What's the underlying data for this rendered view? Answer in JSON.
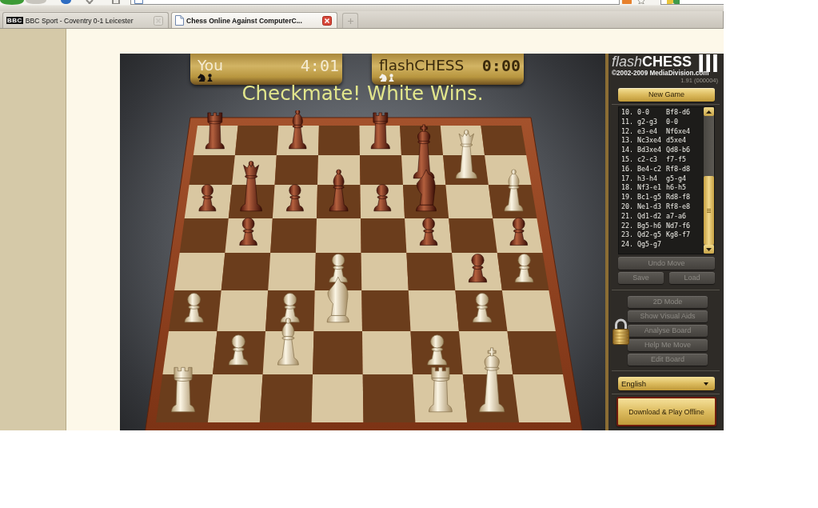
{
  "browser": {
    "tabs": [
      {
        "logo": "BBC",
        "title": "BBC Sport - Coventry 0-1 Leicester",
        "selected": false
      },
      {
        "title": "Chess Online Against ComputerC...",
        "selected": true
      }
    ]
  },
  "game": {
    "players": [
      {
        "name": "You",
        "clock": "4:01",
        "active": true,
        "captured": [
          {
            "kind": "knight",
            "white": false
          },
          {
            "kind": "pawn",
            "white": false
          }
        ]
      },
      {
        "name": "flashCHESS",
        "clock": "0:00",
        "active": false,
        "captured": [
          {
            "kind": "knight",
            "white": true
          },
          {
            "kind": "pawn",
            "white": true
          }
        ]
      }
    ],
    "status": "Checkmate! White Wins.",
    "board": {
      "ranks": [
        [
          {
            "kind": "rook",
            "white": false
          },
          {
            "kind": "empty"
          },
          {
            "kind": "bishop",
            "white": false
          },
          {
            "kind": "empty"
          },
          {
            "kind": "rook",
            "white": false
          },
          {
            "kind": "empty"
          },
          {
            "kind": "empty"
          },
          {
            "kind": "empty"
          }
        ],
        [
          {
            "kind": "empty"
          },
          {
            "kind": "empty"
          },
          {
            "kind": "empty"
          },
          {
            "kind": "empty"
          },
          {
            "kind": "empty"
          },
          {
            "kind": "king",
            "white": false
          },
          {
            "kind": "queen",
            "white": true
          },
          {
            "kind": "empty"
          }
        ],
        [
          {
            "kind": "pawn",
            "white": false
          },
          {
            "kind": "queen",
            "white": false
          },
          {
            "kind": "pawn",
            "white": false
          },
          {
            "kind": "bishop",
            "white": false
          },
          {
            "kind": "pawn",
            "white": false
          },
          {
            "kind": "knight",
            "white": false
          },
          {
            "kind": "empty"
          },
          {
            "kind": "bishop",
            "white": true
          }
        ],
        [
          {
            "kind": "empty"
          },
          {
            "kind": "pawn",
            "white": false
          },
          {
            "kind": "empty"
          },
          {
            "kind": "empty"
          },
          {
            "kind": "empty"
          },
          {
            "kind": "pawn",
            "white": false
          },
          {
            "kind": "empty"
          },
          {
            "kind": "pawn",
            "white": false
          }
        ],
        [
          {
            "kind": "empty"
          },
          {
            "kind": "empty"
          },
          {
            "kind": "empty"
          },
          {
            "kind": "pawn",
            "white": true
          },
          {
            "kind": "empty"
          },
          {
            "kind": "empty"
          },
          {
            "kind": "pawn",
            "white": false
          },
          {
            "kind": "pawn",
            "white": true
          }
        ],
        [
          {
            "kind": "pawn",
            "white": true
          },
          {
            "kind": "empty"
          },
          {
            "kind": "pawn",
            "white": true
          },
          {
            "kind": "knight",
            "white": true
          },
          {
            "kind": "empty"
          },
          {
            "kind": "empty"
          },
          {
            "kind": "pawn",
            "white": true
          },
          {
            "kind": "empty"
          }
        ],
        [
          {
            "kind": "empty"
          },
          {
            "kind": "pawn",
            "white": true
          },
          {
            "kind": "bishop",
            "white": true
          },
          {
            "kind": "empty"
          },
          {
            "kind": "empty"
          },
          {
            "kind": "pawn",
            "white": true
          },
          {
            "kind": "empty"
          },
          {
            "kind": "empty"
          }
        ],
        [
          {
            "kind": "rook",
            "white": true
          },
          {
            "kind": "empty"
          },
          {
            "kind": "empty"
          },
          {
            "kind": "empty"
          },
          {
            "kind": "empty"
          },
          {
            "kind": "rook",
            "white": true
          },
          {
            "kind": "king",
            "white": true
          },
          {
            "kind": "empty"
          }
        ]
      ]
    }
  },
  "panel": {
    "logo": {
      "prefix": "flash",
      "name": "CHESS",
      "numeral": "III"
    },
    "copyright": "©2002-2009 MediaDivision.com",
    "version": "1.91 (000004)",
    "new_game": {
      "label": "New Game",
      "disabled": false
    },
    "moves": [
      {
        "number": "10.",
        "white": "0-0",
        "black": "Bf8-d6"
      },
      {
        "number": "11.",
        "white": "g2-g3",
        "black": "0-0"
      },
      {
        "number": "12.",
        "white": "e3-e4",
        "black": "Nf6xe4"
      },
      {
        "number": "13.",
        "white": "Nc3xe4",
        "black": "d5xe4"
      },
      {
        "number": "14.",
        "white": "Bd3xe4",
        "black": "Qd8-b6"
      },
      {
        "number": "15.",
        "white": "c2-c3",
        "black": "f7-f5"
      },
      {
        "number": "16.",
        "white": "Be4-c2",
        "black": "Rf8-d8"
      },
      {
        "number": "17.",
        "white": "h3-h4",
        "black": "g5-g4"
      },
      {
        "number": "18.",
        "white": "Nf3-e1",
        "black": "h6-h5"
      },
      {
        "number": "19.",
        "white": "Bc1-g5",
        "black": "Rd8-f8"
      },
      {
        "number": "20.",
        "white": "Ne1-d3",
        "black": "Rf8-e8"
      },
      {
        "number": "21.",
        "white": "Qd1-d2",
        "black": "a7-a6"
      },
      {
        "number": "22.",
        "white": "Bg5-h6",
        "black": "Nd7-f6"
      },
      {
        "number": "23.",
        "white": "Qd2-g5",
        "black": "Kg8-f7"
      },
      {
        "number": "24.",
        "white": "Qg5-g7"
      }
    ],
    "undo": {
      "label": "Undo Move",
      "disabled": true
    },
    "file_buttons": [
      {
        "label": "Save",
        "disabled": true
      },
      {
        "label": "Load",
        "disabled": true
      }
    ],
    "tools": {
      "locked": true,
      "buttons": [
        {
          "label": "2D Mode",
          "disabled": true
        },
        {
          "label": "Show Visual Aids",
          "disabled": true
        },
        {
          "label": "Analyse Board",
          "disabled": true
        },
        {
          "label": "Help Me Move",
          "disabled": true
        },
        {
          "label": "Edit Board",
          "disabled": true
        }
      ]
    },
    "language": {
      "value": "English"
    },
    "download": {
      "label": "Download & Play Offline"
    }
  }
}
